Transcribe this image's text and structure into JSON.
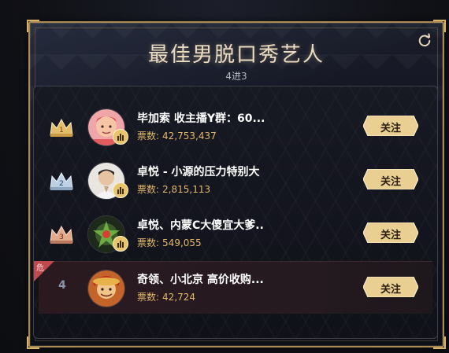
{
  "header": {
    "title": "最佳男脱口秀艺人",
    "subtitle": "4进3",
    "refresh_icon": "refresh-icon"
  },
  "colors": {
    "gold": "#d9b36a",
    "votes": "#e3b86a",
    "danger": "#c0494e"
  },
  "entries": [
    {
      "rank": "1",
      "badge": "gold-crown",
      "name": "毕加索 收主播Y群：60...",
      "votes_label": "票数:",
      "votes": "42,753,437",
      "follow_label": "关注"
    },
    {
      "rank": "2",
      "badge": "silver-crown",
      "name": "卓悦 - 小源的压力特别大",
      "votes_label": "票数:",
      "votes": "2,815,113",
      "follow_label": "关注"
    },
    {
      "rank": "3",
      "badge": "bronze-crown",
      "name": "卓悦、内蒙C大傻宜大爹..",
      "votes_label": "票数:",
      "votes": "549,055",
      "follow_label": "关注"
    },
    {
      "rank": "4",
      "badge": "danger-tag",
      "danger_text": "危",
      "name": "奇领、小北京 高价收购...",
      "votes_label": "票数:",
      "votes": "42,724",
      "follow_label": "关注"
    }
  ]
}
